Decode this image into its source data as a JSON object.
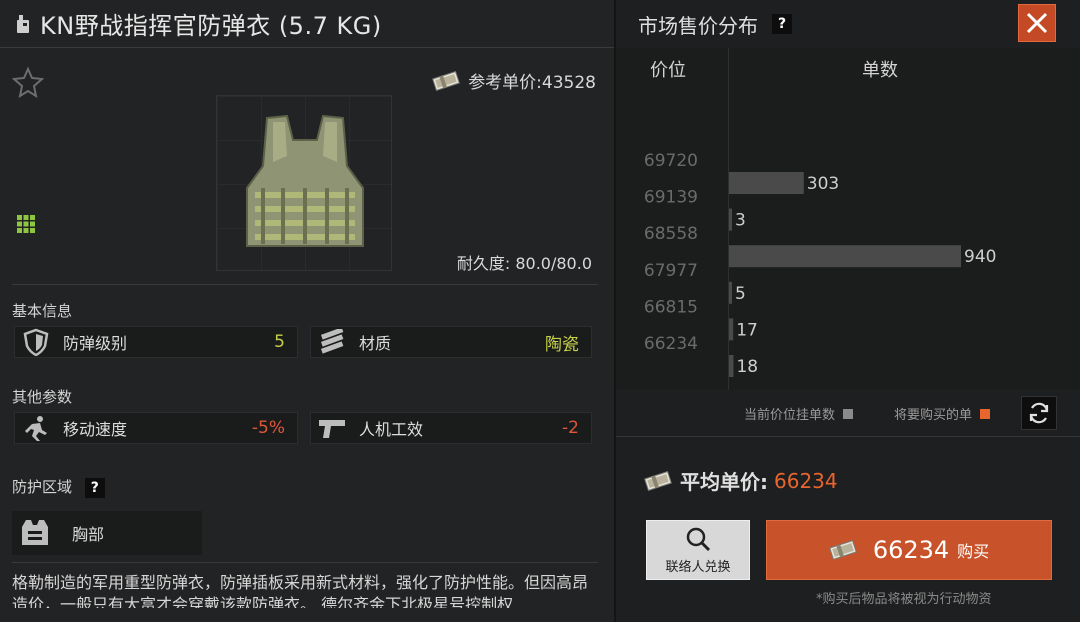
{
  "item": {
    "title": "KN野战指挥官防弹衣 (5.7 KG)",
    "ref_price_label": "参考单价:43528",
    "durability": "耐久度: 80.0/80.0"
  },
  "basic_info": {
    "heading": "基本信息",
    "armor_class_label": "防弹级别",
    "armor_class_value": "5",
    "material_label": "材质",
    "material_value": "陶瓷"
  },
  "other_params": {
    "heading": "其他参数",
    "move_speed_label": "移动速度",
    "move_speed_value": "-5%",
    "ergonomics_label": "人机工效",
    "ergonomics_value": "-2"
  },
  "protection": {
    "heading": "防护区域",
    "help": "?",
    "zone": "胸部"
  },
  "description": "格勒制造的军用重型防弹衣，防弹插板采用新式材料，强化了防护性能。但因高昂造价，一般只有大富才会穿戴该款防弹衣。  德尔齐金下北极星号控制权",
  "market": {
    "title": "市场售价分布",
    "help": "?",
    "col_price": "价位",
    "col_count": "单数",
    "legend_current": "当前价位挂单数",
    "legend_buy": "将要购买的单",
    "avg_label": "平均单价:",
    "avg_value": "66234",
    "contact_label": "联络人兑换",
    "buy_price": "66234",
    "buy_label": "购买",
    "note": "*购买后物品将被视为行动物资"
  },
  "colors": {
    "accent": "#e8662e",
    "positive": "#c6d04a",
    "negative": "#e0573a",
    "bar": "#4a4a4a"
  },
  "chart_data": {
    "type": "bar",
    "orientation": "horizontal",
    "price_ticks": [
      "69720",
      "69139",
      "68558",
      "67977",
      "66815",
      "66234"
    ],
    "bars": [
      {
        "label": "303",
        "value": 303
      },
      {
        "label": "3",
        "value": 3
      },
      {
        "label": "940",
        "value": 940
      },
      {
        "label": "5",
        "value": 5
      },
      {
        "label": "17",
        "value": 17
      },
      {
        "label": "18",
        "value": 18
      }
    ],
    "xlabel": "单数",
    "ylabel": "价位",
    "xlim": [
      0,
      940
    ]
  }
}
